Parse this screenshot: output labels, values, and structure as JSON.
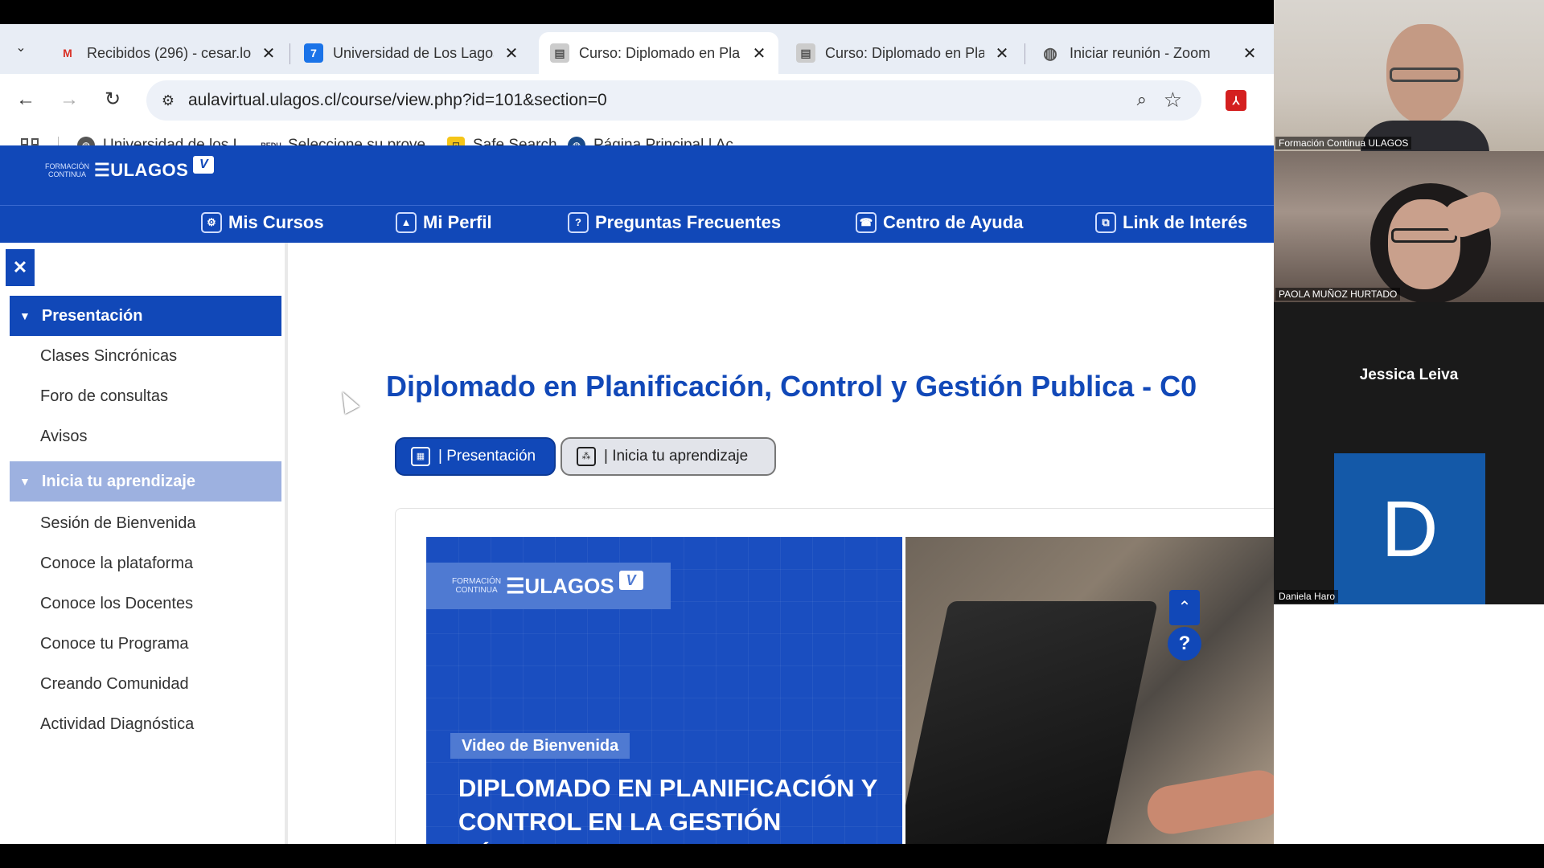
{
  "tabs": [
    {
      "title": "Recibidos (296) - cesar.lo",
      "favicon": "gmail-icon",
      "active": false
    },
    {
      "title": "Universidad de Los Lagos",
      "favicon": "calendar-icon",
      "active": false
    },
    {
      "title": "Curso: Diplomado en Pla",
      "favicon": "course-icon",
      "active": true
    },
    {
      "title": "Curso: Diplomado en Pla",
      "favicon": "course-icon",
      "active": false
    },
    {
      "title": "Iniciar reunión - Zoom",
      "favicon": "globe-icon",
      "active": false
    }
  ],
  "tab_close": "✕",
  "toolbar": {
    "url": "aulavirtual.ulagos.cl/course/view.php?id=101&section=0"
  },
  "bookmarks": [
    {
      "label": "Universidad de los L...",
      "icon": "globe-icon"
    },
    {
      "label": "Seleccione su prove...",
      "icon": "redu-icon"
    },
    {
      "label": "Safe Search",
      "icon": "safe-search-icon"
    },
    {
      "label": "Página Principal | Ac...",
      "icon": "globe-icon"
    }
  ],
  "site": {
    "logo_small_1": "FORMACIÓN",
    "logo_small_2": "CONTINUA",
    "logo_text": "ULAGOS",
    "logo_badge": "V",
    "nav": [
      "Mis Cursos",
      "Mi Perfil",
      "Preguntas Frecuentes",
      "Centro de Ayuda",
      "Link de Interés"
    ]
  },
  "sidebar": {
    "close_label": "✕",
    "sections": [
      {
        "label": "Presentación",
        "items": [
          "Clases Sincrónicas",
          "Foro de consultas",
          "Avisos"
        ]
      },
      {
        "label": "Inicia tu aprendizaje",
        "items": [
          "Sesión de Bienvenida",
          "Conoce la plataforma",
          "Conoce los Docentes",
          "Conoce tu Programa",
          "Creando Comunidad",
          "Actividad Diagnóstica"
        ]
      }
    ]
  },
  "main": {
    "title": "Diplomado en Planificación, Control y Gestión Publica - C0",
    "buttons": [
      "| Presentación",
      "| Inicia tu aprendizaje"
    ],
    "video": {
      "tag": "Video de Bienvenida",
      "heading_line1": "DIPLOMADO EN PLANIFICACIÓN Y",
      "heading_line2": "CONTROL EN LA GESTIÓN PÚBLICA"
    },
    "help_label": "?"
  },
  "zoom": {
    "participants": [
      {
        "name": "Formación Continua ULAGOS"
      },
      {
        "name": "PAOLA MUÑOZ HURTADO"
      },
      {
        "name": "Jessica Leiva"
      },
      {
        "name": "Daniela Haro",
        "initial": "D"
      }
    ]
  },
  "colors": {
    "brand_blue": "#1148b8",
    "sidebar_active": "#1148b8",
    "sidebar_inactive": "#9db1e0"
  }
}
